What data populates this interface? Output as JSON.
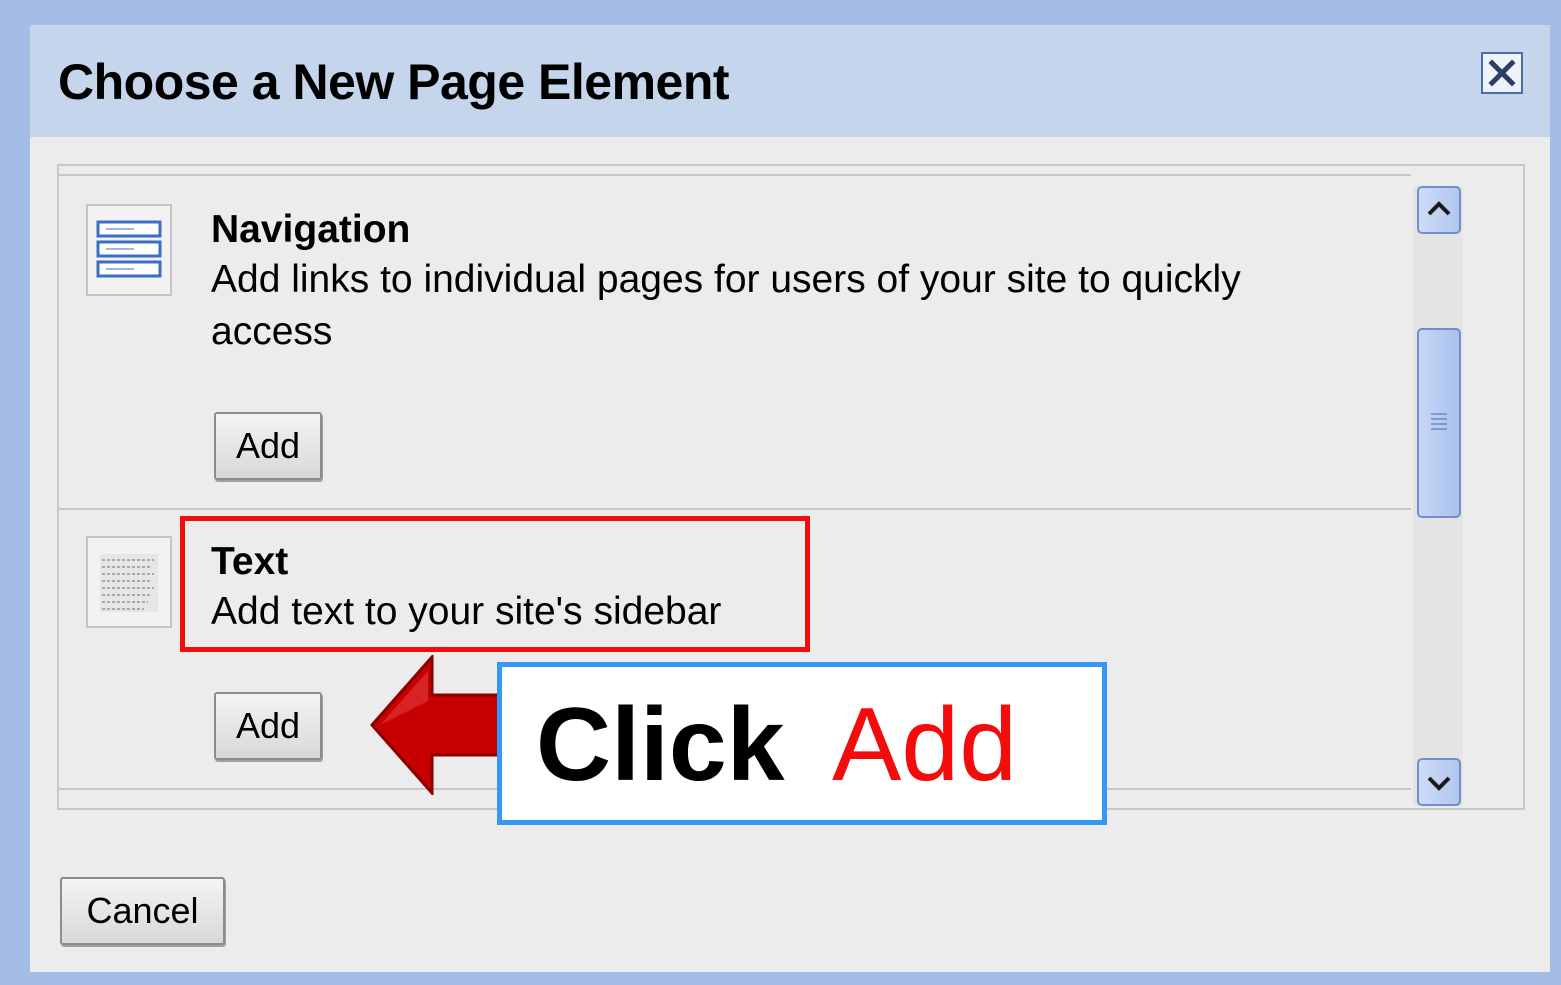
{
  "dialog": {
    "title": "Choose a New Page Element",
    "close_icon": "close-icon"
  },
  "elements": [
    {
      "title": "Navigation",
      "description": "Add links to individual pages for users of your site to quickly access",
      "add_label": "Add",
      "icon": "navigation-icon"
    },
    {
      "title": "Text",
      "description": "Add text to your site's sidebar",
      "add_label": "Add",
      "icon": "text-icon"
    }
  ],
  "scrollbar": {
    "up_icon": "chevron-up-icon",
    "down_icon": "chevron-down-icon"
  },
  "annotation": {
    "click_word": "Click",
    "add_word": "Add",
    "arrow_icon": "left-arrow-icon",
    "highlight_color": "#f20c0c",
    "callout_border_color": "#3498f4"
  },
  "footer": {
    "cancel_label": "Cancel"
  },
  "colors": {
    "frame": "#a4bde6",
    "titlebar": "#c4d5ec",
    "dialog_bg": "#ececec"
  }
}
